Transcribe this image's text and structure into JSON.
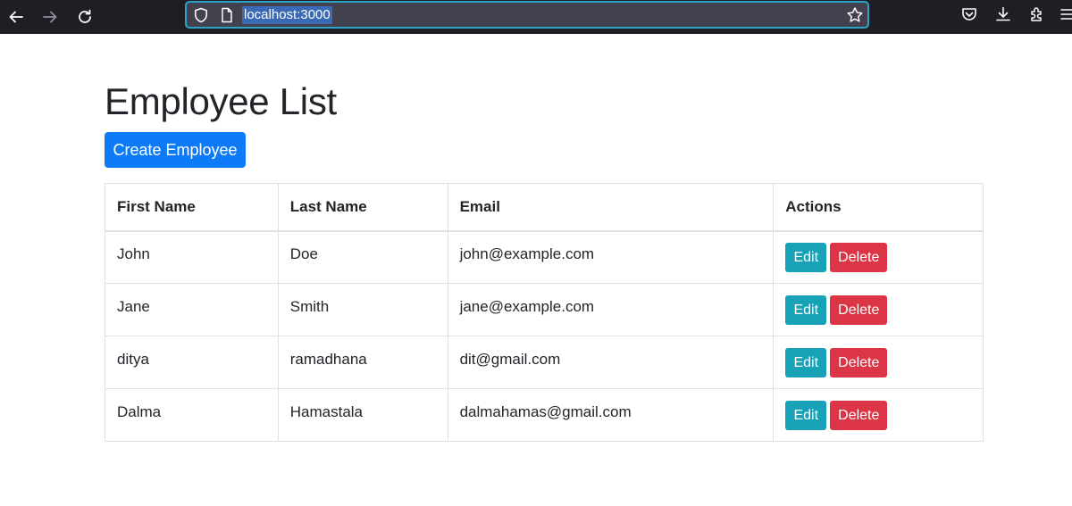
{
  "browser": {
    "url": "localhost:3000"
  },
  "page": {
    "title": "Employee List",
    "create_button_label": "Create Employee"
  },
  "table": {
    "headers": {
      "first_name": "First Name",
      "last_name": "Last Name",
      "email": "Email",
      "actions": "Actions"
    },
    "rows": [
      {
        "first_name": "John",
        "last_name": "Doe",
        "email": "john@example.com"
      },
      {
        "first_name": "Jane",
        "last_name": "Smith",
        "email": "jane@example.com"
      },
      {
        "first_name": "ditya",
        "last_name": "ramadhana",
        "email": "dit@gmail.com"
      },
      {
        "first_name": "Dalma",
        "last_name": "Hamastala",
        "email": "dalmahamas@gmail.com"
      }
    ],
    "edit_label": "Edit",
    "delete_label": "Delete"
  },
  "colors": {
    "primary": "#0d7bf7",
    "info": "#17a2b8",
    "danger": "#dc3545",
    "chrome_background": "#1f1e25",
    "urlbar_focus": "#2aa4c8"
  },
  "icons": {
    "back": "arrow-left-icon",
    "forward": "arrow-right-icon",
    "reload": "reload-icon",
    "tracking_protection": "shield-icon",
    "page": "page-icon",
    "bookmark": "star-icon",
    "pocket": "pocket-icon",
    "downloads": "download-icon",
    "extensions": "extensions-icon",
    "menu": "menu-icon"
  }
}
